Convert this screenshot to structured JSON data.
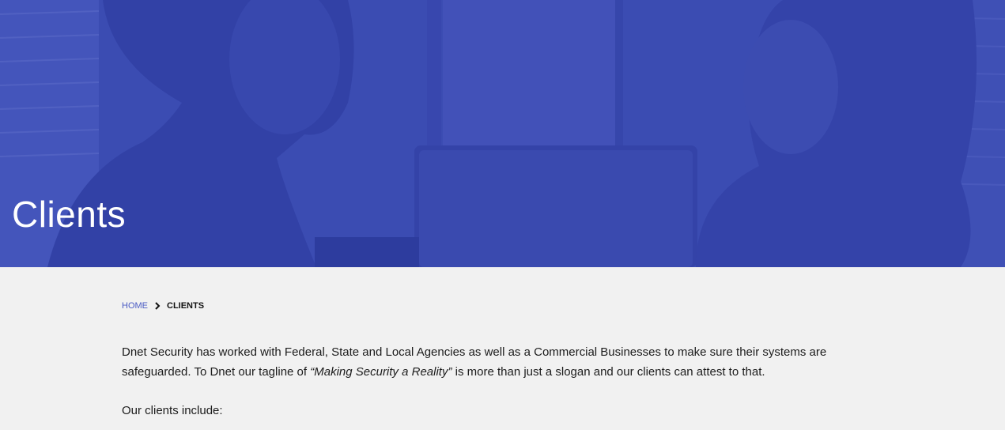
{
  "hero": {
    "title": "Clients",
    "overlay_color": "#3a4bb0"
  },
  "breadcrumb": {
    "home_label": "HOME",
    "separator_icon": "chevron-right-icon",
    "current_label": "CLIENTS"
  },
  "body": {
    "intro_part1": "Dnet Security has worked with Federal, State and Local Agencies as well as a Commercial Businesses to make sure their systems are safeguarded. To Dnet our tagline of ",
    "tagline": "“Making Security a Reality”",
    "intro_part2": " is more than just a slogan and our clients can attest to that.",
    "clients_heading": "Our clients include:"
  },
  "colors": {
    "link": "#4a5bc4",
    "background": "#f1f1f1"
  }
}
